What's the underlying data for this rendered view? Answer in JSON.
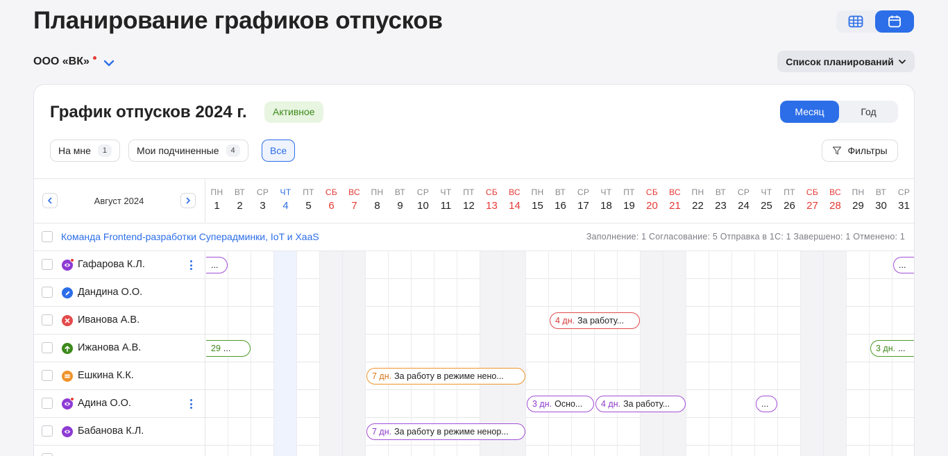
{
  "page": {
    "title": "Планирование графиков отпусков",
    "org_name": "ООО «ВК»",
    "plan_list_label": "Список планирований",
    "view_icons": [
      "table-icon",
      "calendar-icon"
    ]
  },
  "schedule": {
    "title": "График отпусков 2024 г.",
    "status": "Активное",
    "period_tabs": {
      "month": "Месяц",
      "year": "Год"
    },
    "chips": [
      {
        "label": "На мне",
        "count": "1"
      },
      {
        "label": "Мои подчиненные",
        "count": "4"
      },
      {
        "label": "Все"
      }
    ],
    "filters_label": "Фильтры",
    "month_label": "Август 2024"
  },
  "days": [
    {
      "w": "ПН",
      "n": "1"
    },
    {
      "w": "ВТ",
      "n": "2"
    },
    {
      "w": "СР",
      "n": "3"
    },
    {
      "w": "ЧТ",
      "n": "4",
      "today": true
    },
    {
      "w": "ПТ",
      "n": "5"
    },
    {
      "w": "СБ",
      "n": "6",
      "we": true
    },
    {
      "w": "ВС",
      "n": "7",
      "we": true
    },
    {
      "w": "ПН",
      "n": "8"
    },
    {
      "w": "ВТ",
      "n": "9"
    },
    {
      "w": "СР",
      "n": "10"
    },
    {
      "w": "ЧТ",
      "n": "11"
    },
    {
      "w": "ПТ",
      "n": "12"
    },
    {
      "w": "СБ",
      "n": "13",
      "we": true
    },
    {
      "w": "ВС",
      "n": "14",
      "we": true
    },
    {
      "w": "ПН",
      "n": "15"
    },
    {
      "w": "ВТ",
      "n": "16"
    },
    {
      "w": "СР",
      "n": "17"
    },
    {
      "w": "ЧТ",
      "n": "18"
    },
    {
      "w": "ПТ",
      "n": "19"
    },
    {
      "w": "СБ",
      "n": "20",
      "we": true
    },
    {
      "w": "ВС",
      "n": "21",
      "we": true
    },
    {
      "w": "ПН",
      "n": "22"
    },
    {
      "w": "ВТ",
      "n": "23"
    },
    {
      "w": "СР",
      "n": "24"
    },
    {
      "w": "ЧТ",
      "n": "25"
    },
    {
      "w": "ПТ",
      "n": "26"
    },
    {
      "w": "СБ",
      "n": "27",
      "we": true
    },
    {
      "w": "ВС",
      "n": "28",
      "we": true
    },
    {
      "w": "ПН",
      "n": "29"
    },
    {
      "w": "ВТ",
      "n": "30"
    },
    {
      "w": "СР",
      "n": "31"
    }
  ],
  "team": {
    "name": "Команда Frontend-разработки Суперадминки, IoT и XaaS",
    "stats": "Заполнение: 1   Согласование: 5   Отправка в 1С: 1   Завершено: 1   Отменено: 1"
  },
  "employees": [
    {
      "name": "Гафарова К.Л.",
      "status": "eye-icon",
      "color": "#8e3bd4",
      "badge": true,
      "menu": true,
      "bars": [
        {
          "start": 0,
          "end": 1,
          "days": "",
          "text": "...",
          "color": "purple",
          "cut_left": true
        },
        {
          "start": 30,
          "end": 31,
          "days": "",
          "text": "...",
          "color": "purple",
          "cut_right": true
        }
      ]
    },
    {
      "name": "Дандина О.О.",
      "status": "pencil-icon",
      "color": "#2c6ee8",
      "bars": []
    },
    {
      "name": "Иванова А.В.",
      "status": "cross-icon",
      "color": "#e34a4a",
      "bars": [
        {
          "start": 15,
          "end": 19,
          "days": "4 дн.",
          "text": "За работу...",
          "color": "red"
        }
      ]
    },
    {
      "name": "Ижанова А.В.",
      "status": "arrow-up-icon",
      "color": "#3d8a1c",
      "bars": [
        {
          "start": 0,
          "end": 2,
          "days": "29",
          "text": "...",
          "color": "green",
          "cut_left": true
        },
        {
          "start": 29,
          "end": 31,
          "days": "3 дн.",
          "text": "...",
          "color": "green",
          "cut_right": true
        }
      ]
    },
    {
      "name": "Ешкина К.К.",
      "status": "coin-icon",
      "color": "#f0932b",
      "bars": [
        {
          "start": 7,
          "end": 14,
          "days": "7 дн.",
          "text": "За работу в режиме нено...",
          "color": "orange"
        }
      ]
    },
    {
      "name": "Адина О.О.",
      "status": "eye-icon",
      "color": "#8e3bd4",
      "badge": true,
      "menu": true,
      "bars": [
        {
          "start": 14,
          "end": 17,
          "days": "3 дн.",
          "text": "Осно...",
          "color": "purple"
        },
        {
          "start": 17,
          "end": 21,
          "days": "4 дн.",
          "text": "За работу...",
          "color": "purple"
        },
        {
          "start": 24,
          "end": 25,
          "days": "",
          "text": "...",
          "color": "purple"
        }
      ]
    },
    {
      "name": "Бабанова К.Л.",
      "status": "eye-icon",
      "color": "#8e3bd4",
      "bars": [
        {
          "start": 7,
          "end": 14,
          "days": "7 дн.",
          "text": "За работу в режиме ненор...",
          "color": "purple"
        }
      ]
    }
  ]
}
